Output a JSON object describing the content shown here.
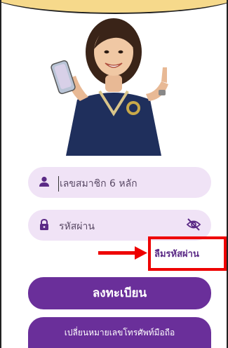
{
  "login": {
    "member_placeholder": "เลขสมาชิก 6 หลัก",
    "password_placeholder": "รหัสผ่าน",
    "forgot_password": "ลืมรหัสผ่าน",
    "register_button": "ลงทะเบียน",
    "change_phone_button": "เปลี่ยนหมายเลขโทรศัพท์มือถือ"
  },
  "icons": {
    "member": "person-icon",
    "password": "lock-icon",
    "visibility": "eye-off-icon",
    "annotation": "right-arrow-icon"
  },
  "colors": {
    "accent": "#6a2f9a",
    "field_bg": "#f0e3f6",
    "highlight": "#ee0000",
    "header": "#f6d98b"
  }
}
